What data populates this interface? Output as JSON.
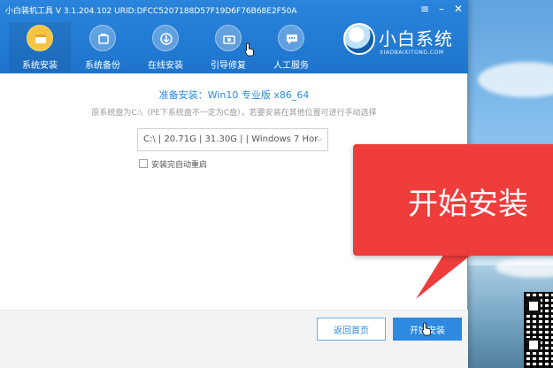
{
  "window": {
    "title": "小白装机工具 V 3.1.204.102 URID:DFCC5207188D57F19D6F76B68E2F50A",
    "controls": {
      "menu": "≡",
      "minimize": "–",
      "close": "✕"
    }
  },
  "nav": [
    {
      "label": "系统安装",
      "icon": "system-install-icon",
      "active": true
    },
    {
      "label": "系统备份",
      "icon": "backup-icon",
      "active": false
    },
    {
      "label": "在线安装",
      "icon": "online-install-icon",
      "active": false
    },
    {
      "label": "引导修复",
      "icon": "boot-repair-icon",
      "active": false
    },
    {
      "label": "人工服务",
      "icon": "chat-service-icon",
      "active": false
    }
  ],
  "logo": {
    "name": "小白系统",
    "subtitle": "XIAOBAIXITONG.COM"
  },
  "main": {
    "heading": "准备安装：Win10 专业版 x86_64",
    "subtext": "原系统盘为C:\\（PE下系统盘不一定为C盘），若要安装在其他位置可进行手动选择",
    "partition_select": {
      "value": "C:\\ | 20.71G | 31.30G |  | Windows 7 Hor",
      "caret": "⌵"
    },
    "auto_restart": {
      "label": "安装完自动重启",
      "checked": false
    }
  },
  "footer": {
    "back_label": "返回首页",
    "start_label": "开始安装"
  },
  "overlay": {
    "callout_text": "开始安装"
  },
  "colors": {
    "header_blue": "#1e74cc",
    "accent_blue": "#2d8ae0",
    "callout_red": "#ee3d3b",
    "active_nav": "#f6c445"
  }
}
